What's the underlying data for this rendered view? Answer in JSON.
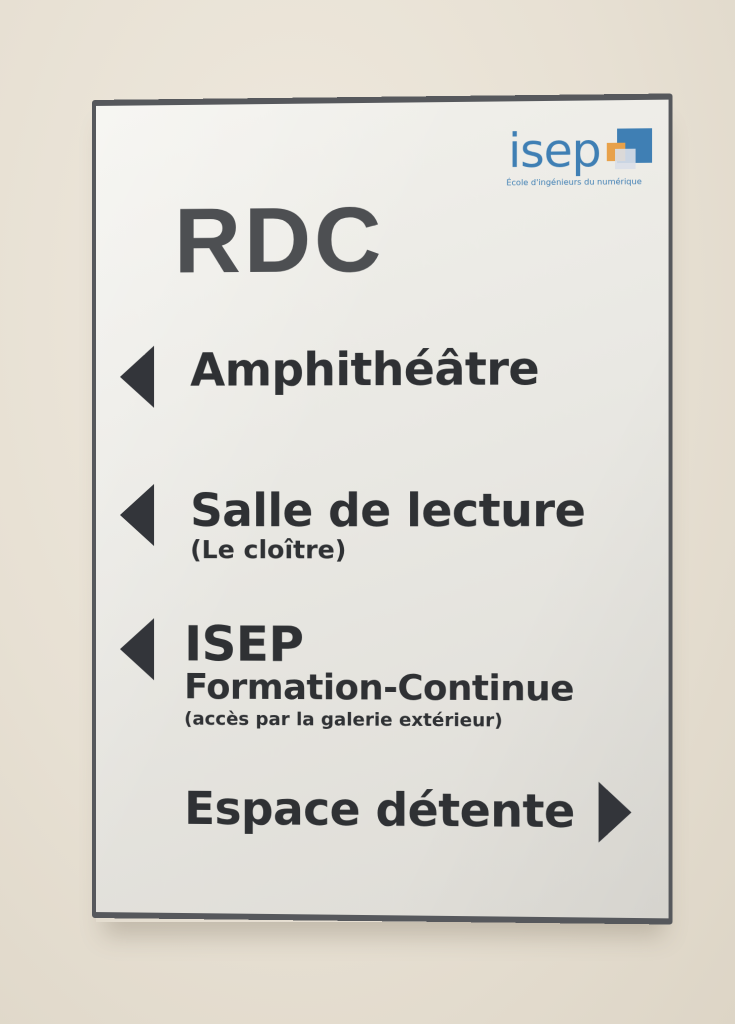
{
  "sign": {
    "logo": {
      "wordmark": "isep",
      "tagline": "École d'ingénieurs du numérique",
      "colors": {
        "blue": "#3f7fb4",
        "orange": "#e8a14a"
      }
    },
    "floor": "RDC",
    "directions": [
      {
        "direction": "left",
        "label": "Amphithéâtre"
      },
      {
        "direction": "left",
        "label": "Salle de lecture",
        "sublabel": "(Le cloître)"
      },
      {
        "direction": "left",
        "label": "ISEP",
        "sublabel": "Formation-Continue",
        "note": "(accès par la galerie extérieur)"
      },
      {
        "direction": "right",
        "label": "Espace détente"
      }
    ],
    "text_color": "#2f3134",
    "frame_color": "#56585c"
  }
}
